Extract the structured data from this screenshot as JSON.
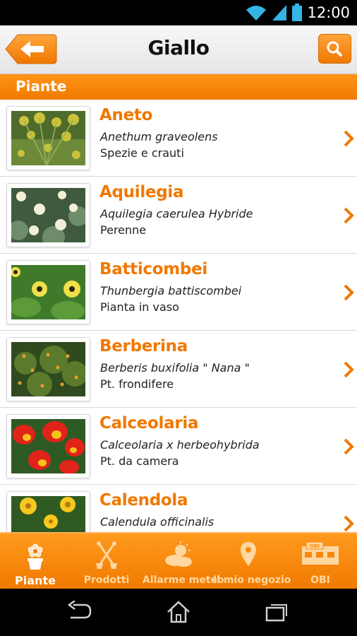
{
  "status_bar": {
    "time": "12:00"
  },
  "header": {
    "title": "Giallo",
    "back_icon": "arrow-left-icon",
    "search_icon": "search-icon"
  },
  "section": {
    "label": "Piante"
  },
  "plants": [
    {
      "name": "Aneto",
      "latin": "Anethum graveolens",
      "category": "Spezie e crauti"
    },
    {
      "name": "Aquilegia",
      "latin": "Aquilegia caerulea Hybride",
      "category": "Perenne"
    },
    {
      "name": "Batticombei",
      "latin": "Thunbergia battiscombei",
      "category": "Pianta in vaso"
    },
    {
      "name": "Berberina",
      "latin": "Berberis buxifolia \" Nana \"",
      "category": "Pt. frondifere"
    },
    {
      "name": "Calceolaria",
      "latin": "Calceolaria x herbeohybrida",
      "category": "Pt. da camera"
    },
    {
      "name": "Calendola",
      "latin": "Calendula officinalis",
      "category": ""
    }
  ],
  "bottom_nav": [
    {
      "label": "Piante",
      "icon": "flower-pot-icon",
      "active": true
    },
    {
      "label": "Prodotti",
      "icon": "garden-tools-icon",
      "active": false
    },
    {
      "label": "Allarme meteo",
      "icon": "weather-icon",
      "active": false
    },
    {
      "label": "Il mio negozio",
      "icon": "location-pin-icon",
      "active": false
    },
    {
      "label": "OBI",
      "icon": "obi-store-icon",
      "active": false
    }
  ],
  "colors": {
    "accent": "#f07800",
    "header_bg": "#efefef",
    "nav_bg": "#f7870e"
  }
}
